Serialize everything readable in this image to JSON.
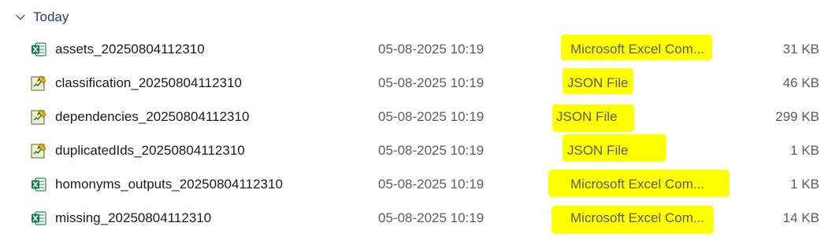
{
  "group": {
    "title": "Today",
    "chevron_icon": "chevron-down-icon"
  },
  "highlight_color": "#ffff00",
  "files": [
    {
      "name": "assets_20250804112310",
      "date": "05-08-2025 10:19",
      "type": "Microsoft Excel Com...",
      "size": "31 KB",
      "icon": "excel-icon",
      "highlighted": true
    },
    {
      "name": "classification_20250804112310",
      "date": "05-08-2025 10:19",
      "type": "JSON File",
      "size": "46 KB",
      "icon": "json-file-icon",
      "highlighted": true
    },
    {
      "name": "dependencies_20250804112310",
      "date": "05-08-2025 10:19",
      "type": "JSON File",
      "size": "299 KB",
      "icon": "json-file-icon",
      "highlighted": true
    },
    {
      "name": "duplicatedIds_20250804112310",
      "date": "05-08-2025 10:19",
      "type": "JSON File",
      "size": "1 KB",
      "icon": "json-file-icon",
      "highlighted": true
    },
    {
      "name": "homonyms_outputs_20250804112310",
      "date": "05-08-2025 10:19",
      "type": "Microsoft Excel Com...",
      "size": "1 KB",
      "icon": "excel-icon",
      "highlighted": true
    },
    {
      "name": "missing_20250804112310",
      "date": "05-08-2025 10:19",
      "type": "Microsoft Excel Com...",
      "size": "14 KB",
      "icon": "excel-icon",
      "highlighted": true
    }
  ]
}
